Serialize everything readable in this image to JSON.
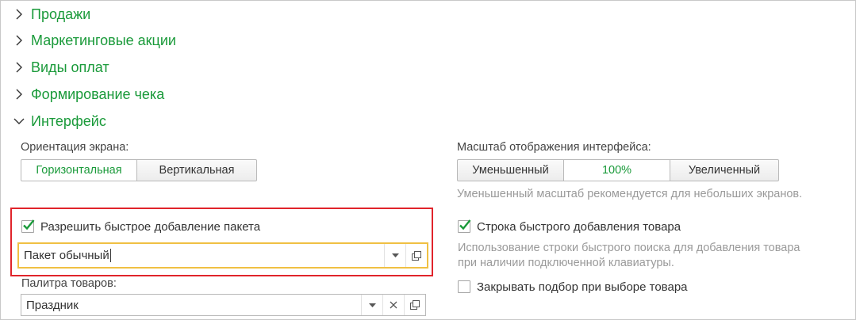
{
  "sections": [
    {
      "label": "Продажи",
      "expanded": false
    },
    {
      "label": "Маркетинговые акции",
      "expanded": false
    },
    {
      "label": "Виды оплат",
      "expanded": false
    },
    {
      "label": "Формирование чека",
      "expanded": false
    },
    {
      "label": "Интерфейс",
      "expanded": true
    }
  ],
  "orientation": {
    "label": "Ориентация экрана:",
    "options": [
      "Горизонтальная",
      "Вертикальная"
    ],
    "selected": "Горизонтальная"
  },
  "scale": {
    "label": "Масштаб отображения интерфейса:",
    "options": [
      "Уменьшенный",
      "100%",
      "Увеличенный"
    ],
    "selected": "100%",
    "hint": "Уменьшенный масштаб рекомендуется для небольших экранов."
  },
  "package": {
    "checkbox_label": "Разрешить быстрое добавление пакета",
    "checked": true,
    "value": "Пакет обычный"
  },
  "quick_add": {
    "checkbox_label": "Строка быстрого добавления товара",
    "checked": true,
    "hint_line1": "Использование строки быстрого поиска для добавления товара",
    "hint_line2": "при наличии подключенной клавиатуры."
  },
  "close_on_select": {
    "checkbox_label": "Закрывать подбор при выборе товара",
    "checked": false
  },
  "palette": {
    "label": "Палитра товаров:",
    "value": "Праздник"
  },
  "colors": {
    "accent": "#1a9a3a",
    "highlight": "#e0242b",
    "focus": "#f0c043"
  },
  "icons": {
    "collapsed": "chevron-right-icon",
    "expanded": "chevron-down-icon",
    "dropdown": "dropdown-arrow-icon",
    "clear": "clear-icon",
    "open": "open-form-icon",
    "check": "checkmark-icon"
  }
}
